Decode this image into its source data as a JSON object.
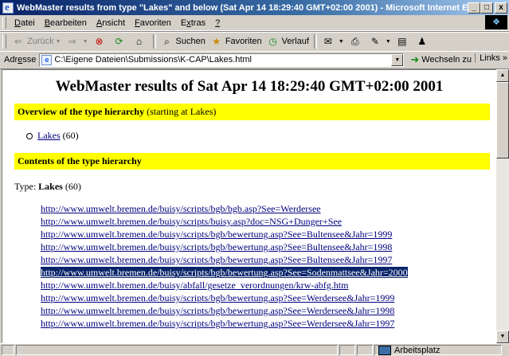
{
  "window": {
    "title": "WebMaster results from type \"Lakes\" and below (Sat Apr 14 18:29:40 GMT+02:00 2001) - Microsoft Internet Explorer",
    "min": "_",
    "max": "□",
    "close": "x"
  },
  "menu": [
    {
      "u": "D",
      "rest": "atei"
    },
    {
      "u": "B",
      "rest": "earbeiten"
    },
    {
      "u": "A",
      "rest": "nsicht"
    },
    {
      "u": "F",
      "rest": "avoriten"
    },
    {
      "u": "Ext",
      "rest": "ras",
      "pre": "E",
      "mid": "x",
      "post": "tras"
    },
    {
      "u": "?",
      "rest": ""
    }
  ],
  "toolbar": {
    "back": "Zurück",
    "search": "Suchen",
    "favorites": "Favoriten",
    "history": "Verlauf"
  },
  "address": {
    "label_u": "e",
    "label_pre": "Adr",
    "label_post": "sse",
    "url": "C:\\Eigene Dateien\\Submissions\\K-CAP\\Lakes.html",
    "go": "Wechseln zu",
    "links": "Links »"
  },
  "page": {
    "heading": "WebMaster results of Sat Apr 14 18:29:40 GMT+02:00 2001",
    "overview_bold": "Overview of the type hierarchy",
    "overview_rest": " (starting at Lakes)",
    "overview_item_link": "Lakes",
    "overview_item_count": " (60)",
    "contents_bold": "Contents of the type hierarchy",
    "type_prefix": "Type: ",
    "type_name": "Lakes",
    "type_count": " (60)",
    "urls": [
      "http://www.umwelt.bremen.de/buisy/scripts/bgb/bgb.asp?See=Werdersee",
      "http://www.umwelt.bremen.de/buisy/scripts/buisy.asp?doc=NSG+Dunger+See",
      "http://www.umwelt.bremen.de/buisy/scripts/bgb/bewertung.asp?See=Bultensee&Jahr=1999",
      "http://www.umwelt.bremen.de/buisy/scripts/bgb/bewertung.asp?See=Bultensee&Jahr=1998",
      "http://www.umwelt.bremen.de/buisy/scripts/bgb/bewertung.asp?See=Bultensee&Jahr=1997",
      "http://www.umwelt.bremen.de/buisy/scripts/bgb/bewertung.asp?See=Sodenmattsee&Jahr=2000",
      "http://www.umwelt.bremen.de/buisy/abfall/gesetze_verordnungen/krw-abfg.htm",
      "http://www.umwelt.bremen.de/buisy/scripts/bgb/bewertung.asp?See=Werdersee&Jahr=1999",
      "http://www.umwelt.bremen.de/buisy/scripts/bgb/bewertung.asp?See=Werdersee&Jahr=1998",
      "http://www.umwelt.bremen.de/buisy/scripts/bgb/bewertung.asp?See=Werdersee&Jahr=1997"
    ],
    "selected_index": 5
  },
  "status": {
    "zone": "Arbeitsplatz"
  }
}
